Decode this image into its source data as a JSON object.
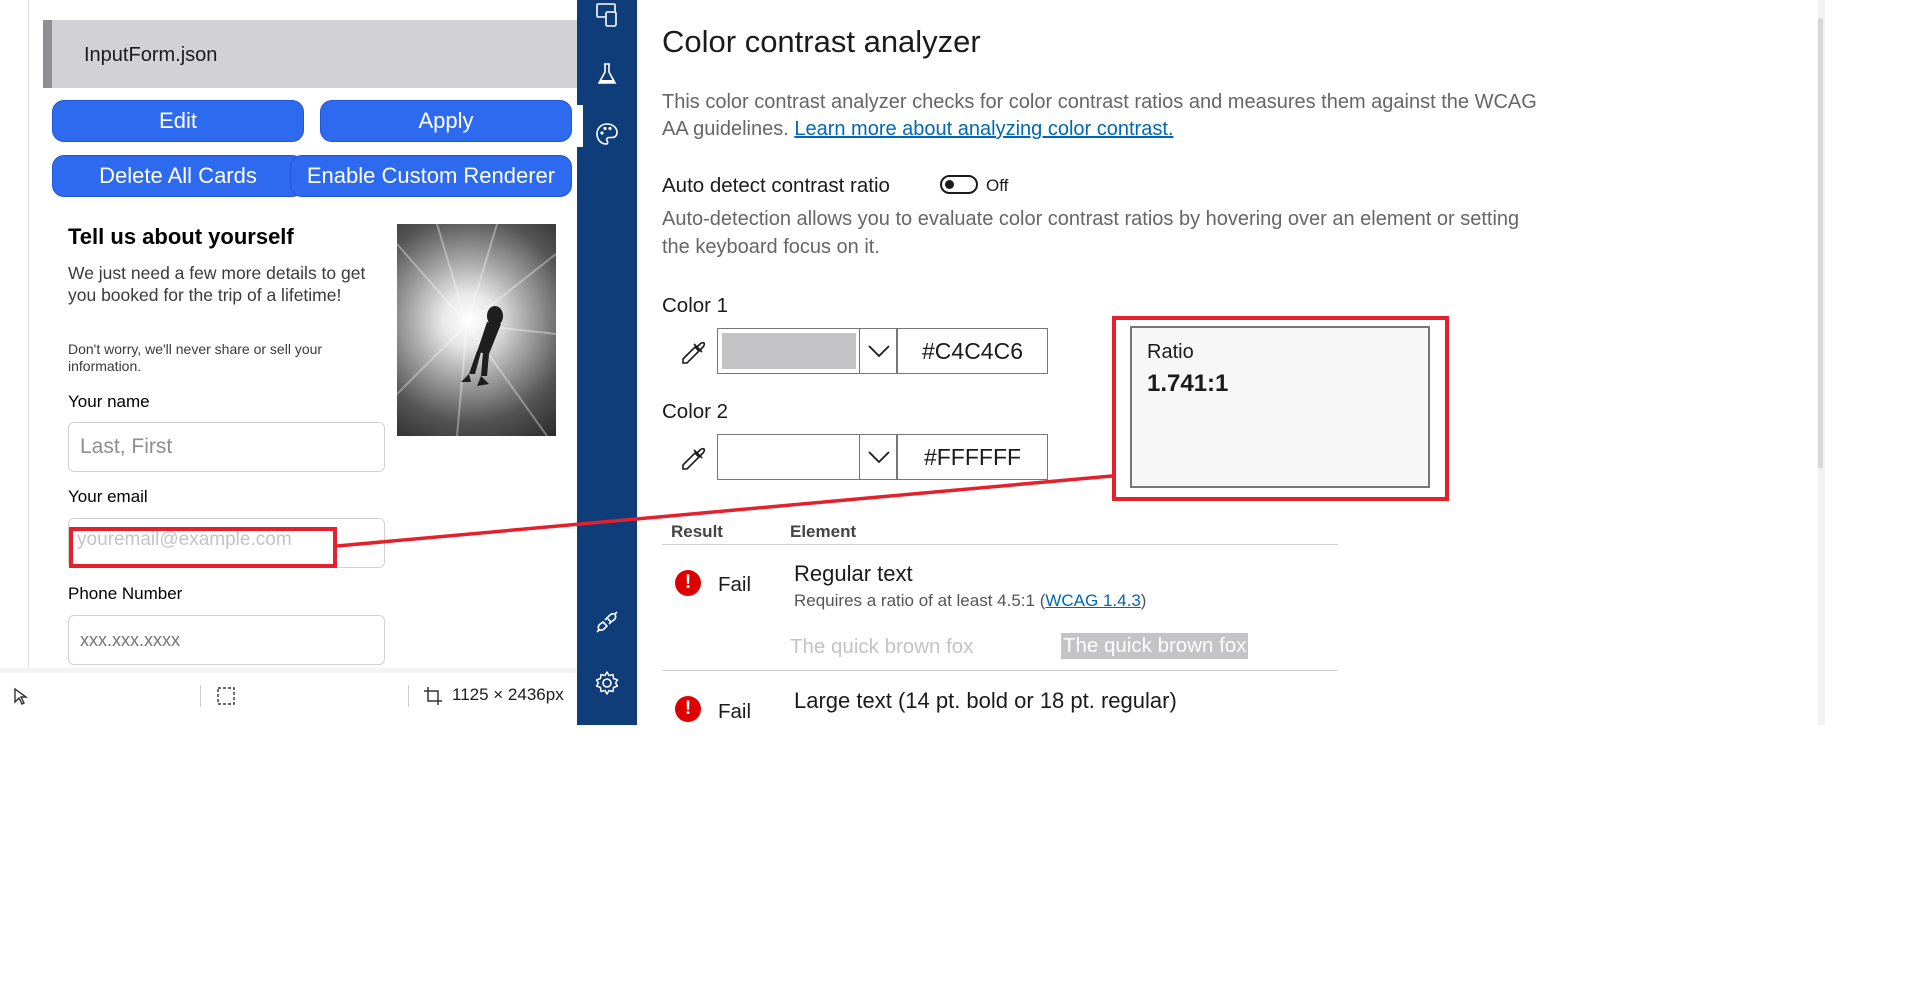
{
  "left_panel": {
    "file_name": "InputForm.json",
    "buttons": {
      "edit": "Edit",
      "apply": "Apply",
      "delete_all": "Delete All Cards",
      "enable_renderer": "Enable Custom Renderer"
    },
    "form": {
      "title": "Tell us about yourself",
      "description": "We just need a few more details to get you booked for the trip of a lifetime!",
      "note": "Don't worry, we'll never share or sell your information.",
      "name_label": "Your name",
      "name_placeholder": "Last, First",
      "email_label": "Your email",
      "email_placeholder": "youremail@example.com",
      "phone_label": "Phone Number",
      "phone_placeholder": "xxx.xxx.xxxx"
    },
    "status": {
      "dimensions": "1125 × 2436px"
    }
  },
  "tool_strip": {
    "icons": [
      "devices-icon",
      "flask-icon",
      "palette-icon",
      "plug-icon",
      "gear-icon"
    ]
  },
  "analyzer": {
    "title": "Color contrast analyzer",
    "intro": "This color contrast analyzer checks for color contrast ratios and measures them against the WCAG AA guidelines.",
    "intro_link": "Learn more about analyzing color contrast.",
    "auto_detect_label": "Auto detect contrast ratio",
    "toggle_state": "Off",
    "auto_detect_desc": "Auto-detection allows you to evaluate color contrast ratios by hovering over an element or setting the keyboard focus on it.",
    "color1": {
      "label": "Color 1",
      "hex": "#C4C4C6",
      "swatch": "#C4C4C6"
    },
    "color2": {
      "label": "Color 2",
      "hex": "#FFFFFF",
      "swatch": "#FFFFFF"
    },
    "ratio": {
      "label": "Ratio",
      "value": "1.741:1"
    },
    "results": {
      "header_result": "Result",
      "header_element": "Element",
      "rows": [
        {
          "result": "Fail",
          "element": "Regular text",
          "requirement_prefix": "Requires a ratio of at least 4.5:1 (",
          "requirement_link": "WCAG 1.4.3",
          "requirement_suffix": ")",
          "sample_text": "The quick brown fox"
        },
        {
          "result": "Fail",
          "element": "Large text (14 pt. bold or 18 pt. regular)"
        }
      ]
    }
  },
  "colors": {
    "accent_blue": "#2d6af0",
    "strip_blue": "#0f3d79",
    "highlight_red": "#e3202b",
    "fail_red": "#dd0000",
    "link_blue": "#0067b8"
  }
}
